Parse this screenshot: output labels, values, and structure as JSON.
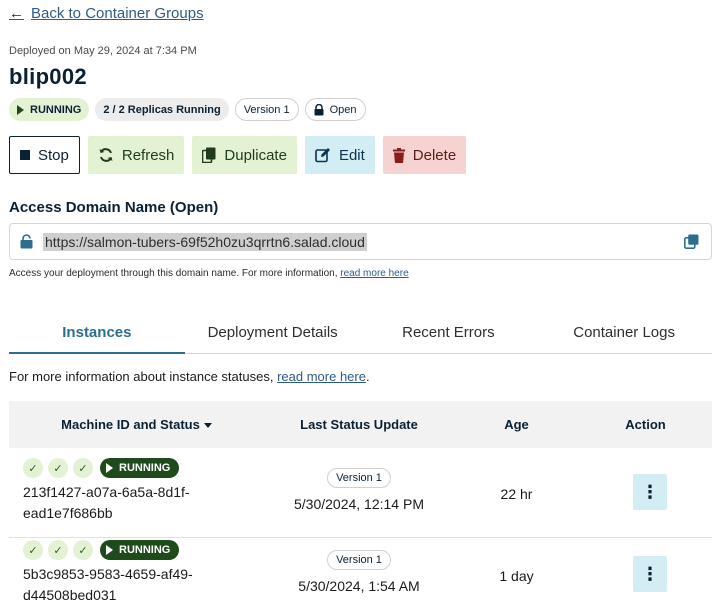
{
  "nav": {
    "back_label": "Back to Container Groups"
  },
  "header": {
    "deployed_text": "Deployed on May 29, 2024 at 7:34 PM",
    "title": "blip002",
    "badges": {
      "status": "RUNNING",
      "replicas": "2 / 2 Replicas Running",
      "version": "Version 1",
      "access": "Open"
    }
  },
  "actions": {
    "stop": "Stop",
    "refresh": "Refresh",
    "duplicate": "Duplicate",
    "edit": "Edit",
    "delete": "Delete"
  },
  "access_domain": {
    "title": "Access Domain Name (Open)",
    "url": "https://salmon-tubers-69f52h0zu3qrrtn6.salad.cloud",
    "note": "Access your deployment through this domain name. For more information, ",
    "note_link": "read more here"
  },
  "tabs": [
    "Instances",
    "Deployment Details",
    "Recent Errors",
    "Container Logs"
  ],
  "instances": {
    "info_text": "For more information about instance statuses, ",
    "info_link": "read more here",
    "info_suffix": ".",
    "columns": [
      "Machine ID and Status",
      "Last Status Update",
      "Age",
      "Action"
    ],
    "rows": [
      {
        "status": "RUNNING",
        "machine_id_line1": "213f1427-a07a-6a5a-8d1f-",
        "machine_id_line2": "ead1e7f686bb",
        "version": "Version 1",
        "last_update": "5/30/2024, 12:14 PM",
        "age": "22 hr"
      },
      {
        "status": "RUNNING",
        "machine_id_line1": "5b3c9853-9583-4659-af49-",
        "machine_id_line2": "d44508bed031",
        "version": "Version 1",
        "last_update": "5/30/2024, 1:54 AM",
        "age": "1 day"
      }
    ]
  },
  "colors": {
    "running_dark": "#1f4a1c",
    "success_light": "#e4f2d4",
    "info_light": "#d2edf4",
    "danger_light": "#f6d3d0",
    "link": "#2d5c88",
    "tab_active": "#2d6e90"
  },
  "icons": {
    "back": "arrow-left-icon",
    "play": "play-icon",
    "lock": "lock-icon",
    "stop": "stop-square-icon",
    "refresh": "refresh-icon",
    "duplicate": "duplicate-icon",
    "edit": "edit-icon",
    "delete": "trash-icon",
    "copy": "copy-icon",
    "check": "check-icon",
    "kebab": "kebab-menu-icon"
  }
}
